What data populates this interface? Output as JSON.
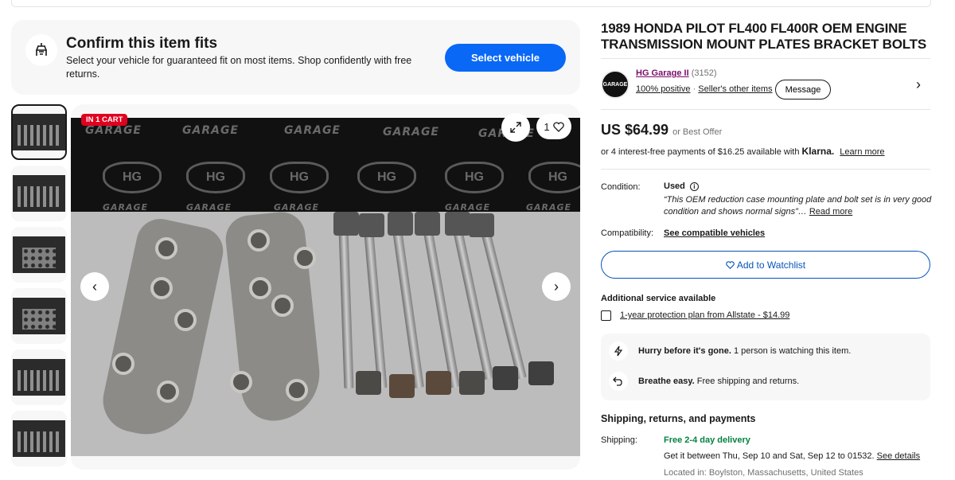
{
  "fit_banner": {
    "title": "Confirm this item fits",
    "text": "Select your vehicle for guaranteed fit on most items. Shop confidently with free returns.",
    "button": "Select vehicle"
  },
  "gallery": {
    "cart_tag": "IN 1 CART",
    "watch_count": "1",
    "watermark_logo": "GARAGE",
    "watermark_badge": "HG"
  },
  "item": {
    "title": "1989 HONDA PILOT FL400 FL400R OEM ENGINE TRANSMISSION MOUNT PLATES BRACKET BOLTS"
  },
  "seller": {
    "name": "HG Garage II",
    "score": "(3152)",
    "positive": "100% positive",
    "other_items": "Seller's other items",
    "message": "Message",
    "avatar_text": "GARAGE"
  },
  "price": {
    "amount": "US $64.99",
    "best_offer": "or Best Offer",
    "installments": "or 4 interest-free payments of $16.25 available with",
    "klarna": "Klarna.",
    "learn_more": "Learn more"
  },
  "condition": {
    "label": "Condition:",
    "value": "Used",
    "quote": "“This OEM reduction case mounting plate and bolt set is in very good condition and shows normal signs”…",
    "read_more": "Read more"
  },
  "compatibility": {
    "label": "Compatibility:",
    "link": "See compatible vehicles"
  },
  "watchlist": {
    "label": "Add to Watchlist"
  },
  "additional": {
    "heading": "Additional service available",
    "plan": "1-year protection plan from Allstate - $14.99"
  },
  "notices": {
    "hurry_bold": "Hurry before it's gone.",
    "hurry_text": "1 person is watching this item.",
    "breathe_bold": "Breathe easy.",
    "breathe_text": "Free shipping and returns."
  },
  "shipping": {
    "heading": "Shipping, returns, and payments",
    "label": "Shipping:",
    "free": "Free 2-4 day delivery",
    "estimate": "Get it between Thu, Sep 10 and Sat, Sep 12 to 01532.",
    "details": "See details",
    "location": "Located in: Boylston, Massachusetts, United States"
  },
  "colors": {
    "accent": "#0968f6",
    "link": "#0654ba",
    "free": "#05823f",
    "tag": "#e0001f"
  }
}
